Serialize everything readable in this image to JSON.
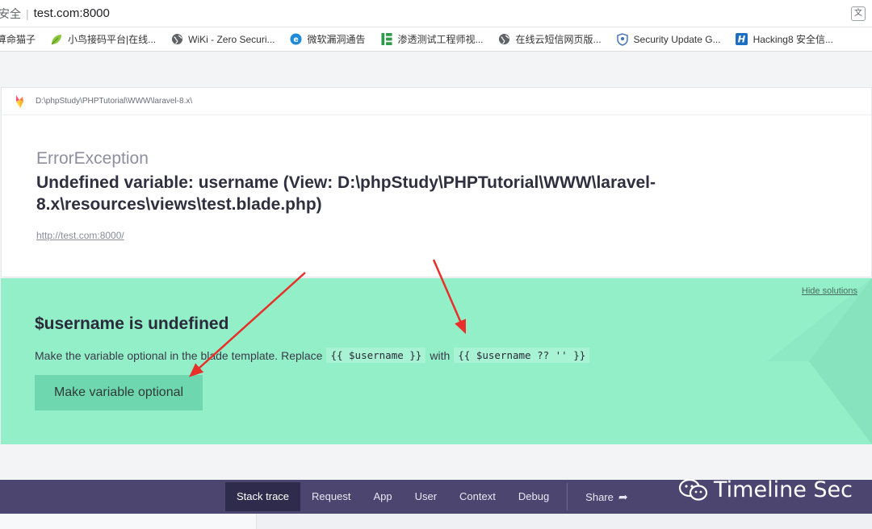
{
  "browser": {
    "security_label": "安全",
    "separator": "|",
    "url": "test.com:8000",
    "translate_icon": "translate-icon"
  },
  "bookmarks": [
    {
      "label": "算命猫子",
      "icon": "none"
    },
    {
      "label": "小鸟接码平台|在线...",
      "icon": "leaf-icon"
    },
    {
      "label": "WiKi - Zero Securi...",
      "icon": "globe-icon"
    },
    {
      "label": "微软漏洞通告",
      "icon": "edge-icon"
    },
    {
      "label": "渗透测试工程师视...",
      "icon": "bookmark-green-icon"
    },
    {
      "label": "在线云短信网页版...",
      "icon": "globe-icon"
    },
    {
      "label": "Security Update G...",
      "icon": "shield-icon"
    },
    {
      "label": "Hacking8 安全信...",
      "icon": "h-icon"
    }
  ],
  "header": {
    "path": "D:\\phpStudy\\PHPTutorial\\WWW\\laravel-8.x\\"
  },
  "exception": {
    "type": "ErrorException",
    "message": "Undefined variable: username (View: D:\\phpStudy\\PHPTutorial\\WWW\\laravel-8.x\\resources\\views\\test.blade.php)",
    "url": "http://test.com:8000/"
  },
  "solution": {
    "hide_label": "Hide solutions",
    "title": "$username is undefined",
    "desc_prefix": "Make the variable optional in the blade template. Replace",
    "code_from": "{{ $username }}",
    "desc_mid": "with",
    "code_to": "{{ $username ?? '' }}",
    "button_label": "Make variable optional"
  },
  "nav": {
    "items": [
      "Stack trace",
      "Request",
      "App",
      "User",
      "Context",
      "Debug"
    ],
    "active": "Stack trace",
    "share_label": "Share"
  },
  "watermark": {
    "text": "Timeline Sec"
  },
  "colors": {
    "solution_bg": "#93efc8",
    "nav_bg": "#4b4570",
    "arrow": "#e8302a"
  }
}
